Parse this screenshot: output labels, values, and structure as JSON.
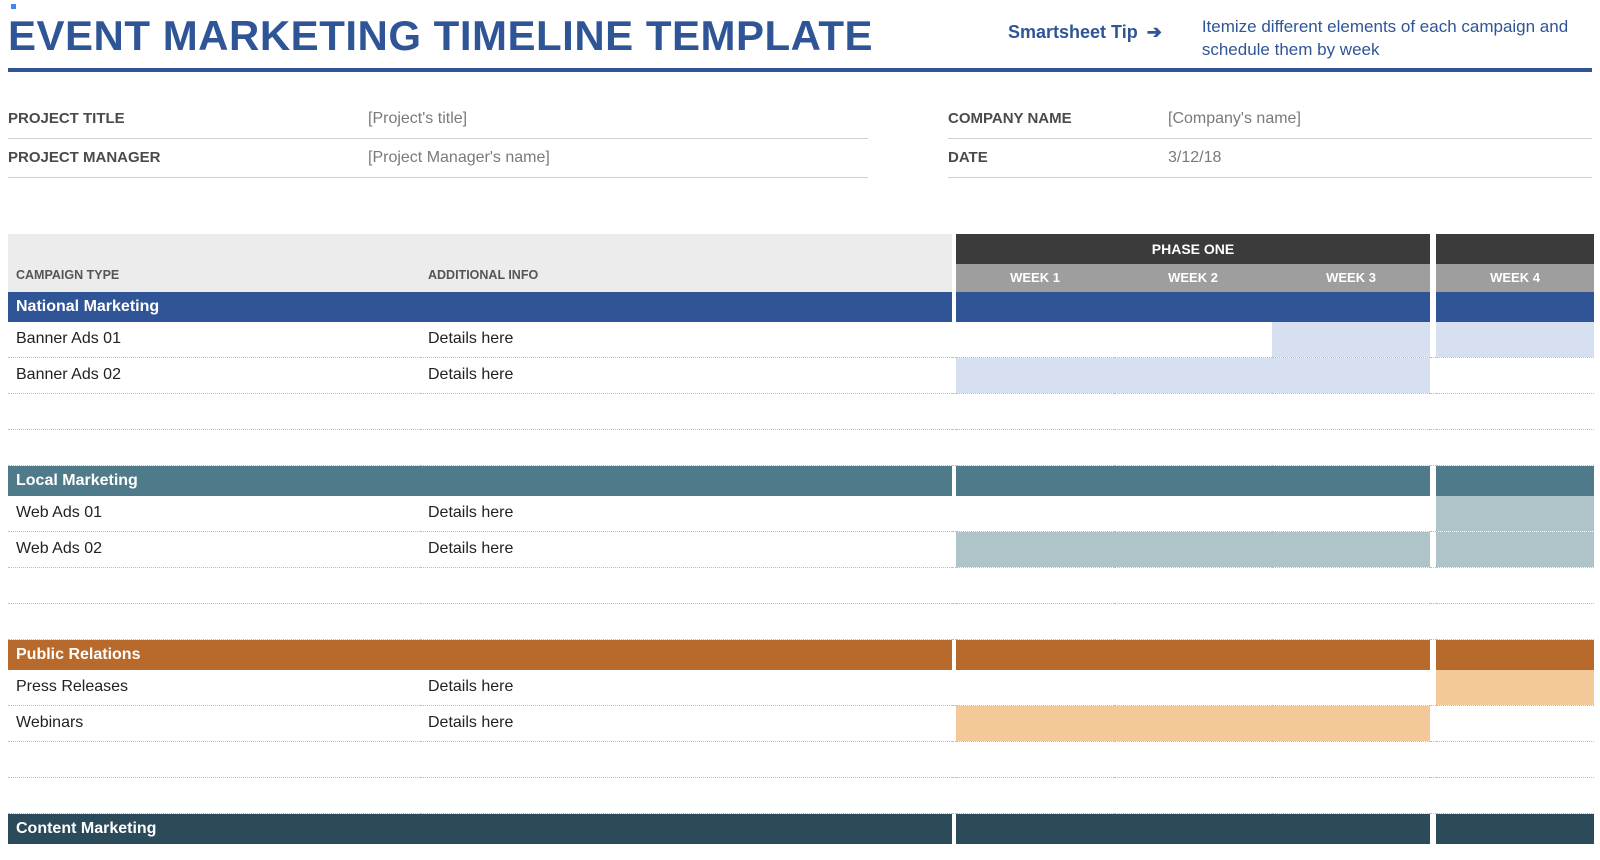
{
  "header": {
    "title": "EVENT MARKETING TIMELINE TEMPLATE",
    "tip_label": "Smartsheet Tip",
    "tip_arrow": "➔",
    "tip_desc": "Itemize different elements of each campaign and schedule them by week"
  },
  "meta": {
    "project_title_label": "PROJECT TITLE",
    "project_title_value": "[Project's title]",
    "project_manager_label": "PROJECT MANAGER",
    "project_manager_value": "[Project Manager's name]",
    "company_label": "COMPANY NAME",
    "company_value": "[Company's name]",
    "date_label": "DATE",
    "date_value": "3/12/18"
  },
  "columns": {
    "campaign_type": "CAMPAIGN TYPE",
    "additional_info": "ADDITIONAL INFO",
    "phase": "PHASE ONE",
    "weeks": [
      "WEEK 1",
      "WEEK 2",
      "WEEK 3",
      "WEEK 4"
    ]
  },
  "sections": [
    {
      "name": "National Marketing",
      "color_class": "c-national",
      "light_class": "c-national-lt",
      "rows": [
        {
          "campaign": "Banner Ads 01",
          "info": "Details here",
          "cells": [
            false,
            false,
            true,
            true
          ]
        },
        {
          "campaign": "Banner Ads 02",
          "info": "Details here",
          "cells": [
            true,
            true,
            true,
            false
          ]
        },
        {
          "campaign": "",
          "info": "",
          "cells": [
            false,
            false,
            false,
            false
          ]
        },
        {
          "campaign": "",
          "info": "",
          "cells": [
            false,
            false,
            false,
            false
          ]
        }
      ]
    },
    {
      "name": "Local Marketing",
      "color_class": "c-local",
      "light_class": "c-local-lt",
      "rows": [
        {
          "campaign": "Web Ads 01",
          "info": "Details here",
          "cells": [
            false,
            false,
            false,
            true
          ]
        },
        {
          "campaign": "Web Ads 02",
          "info": "Details here",
          "cells": [
            true,
            true,
            true,
            true
          ]
        },
        {
          "campaign": "",
          "info": "",
          "cells": [
            false,
            false,
            false,
            false
          ]
        },
        {
          "campaign": "",
          "info": "",
          "cells": [
            false,
            false,
            false,
            false
          ]
        }
      ]
    },
    {
      "name": "Public Relations",
      "color_class": "c-pr",
      "light_class": "c-pr-lt",
      "rows": [
        {
          "campaign": "Press Releases",
          "info": "Details here",
          "cells": [
            false,
            false,
            false,
            true
          ]
        },
        {
          "campaign": "Webinars",
          "info": "Details here",
          "cells": [
            true,
            true,
            true,
            false
          ]
        },
        {
          "campaign": "",
          "info": "",
          "cells": [
            false,
            false,
            false,
            false
          ]
        },
        {
          "campaign": "",
          "info": "",
          "cells": [
            false,
            false,
            false,
            false
          ]
        }
      ]
    },
    {
      "name": "Content Marketing",
      "color_class": "c-content",
      "light_class": "",
      "rows": []
    }
  ]
}
